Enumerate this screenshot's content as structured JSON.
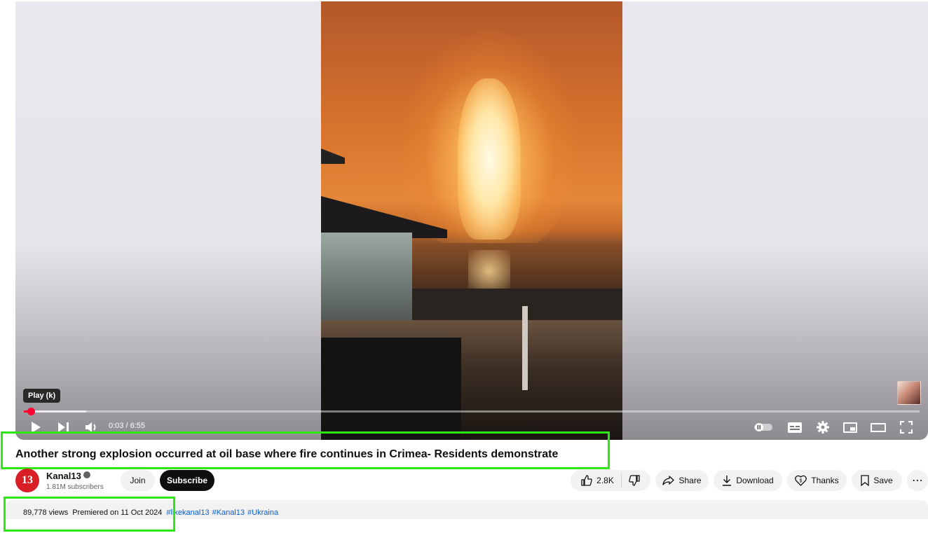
{
  "player": {
    "tooltip": "Play (k)",
    "current_time": "0:03",
    "time_separator": " / ",
    "duration": "6:55",
    "progress_played_fraction": 0.008,
    "progress_buffered_fraction": 0.07,
    "accent_color": "#ff0033"
  },
  "video": {
    "title": "Another strong explosion occurred at oil base where fire continues in Crimea- Residents demonstrate"
  },
  "channel": {
    "avatar_text": "13",
    "name": "Kanal13",
    "subscribers": "1.81M subscribers",
    "join_label": "Join",
    "subscribe_label": "Subscribe"
  },
  "actions": {
    "likes": "2.8K",
    "share_label": "Share",
    "download_label": "Download",
    "thanks_label": "Thanks",
    "save_label": "Save",
    "more_label": "⋯"
  },
  "description": {
    "views": "89,778 views",
    "premiered": "Premiered on 11 Oct 2024",
    "hashtags": [
      "#likekanal13",
      "#Kanal13",
      "#Ukraina"
    ],
    "link_color": "#065fd4"
  },
  "highlight_color": "#2ee815"
}
